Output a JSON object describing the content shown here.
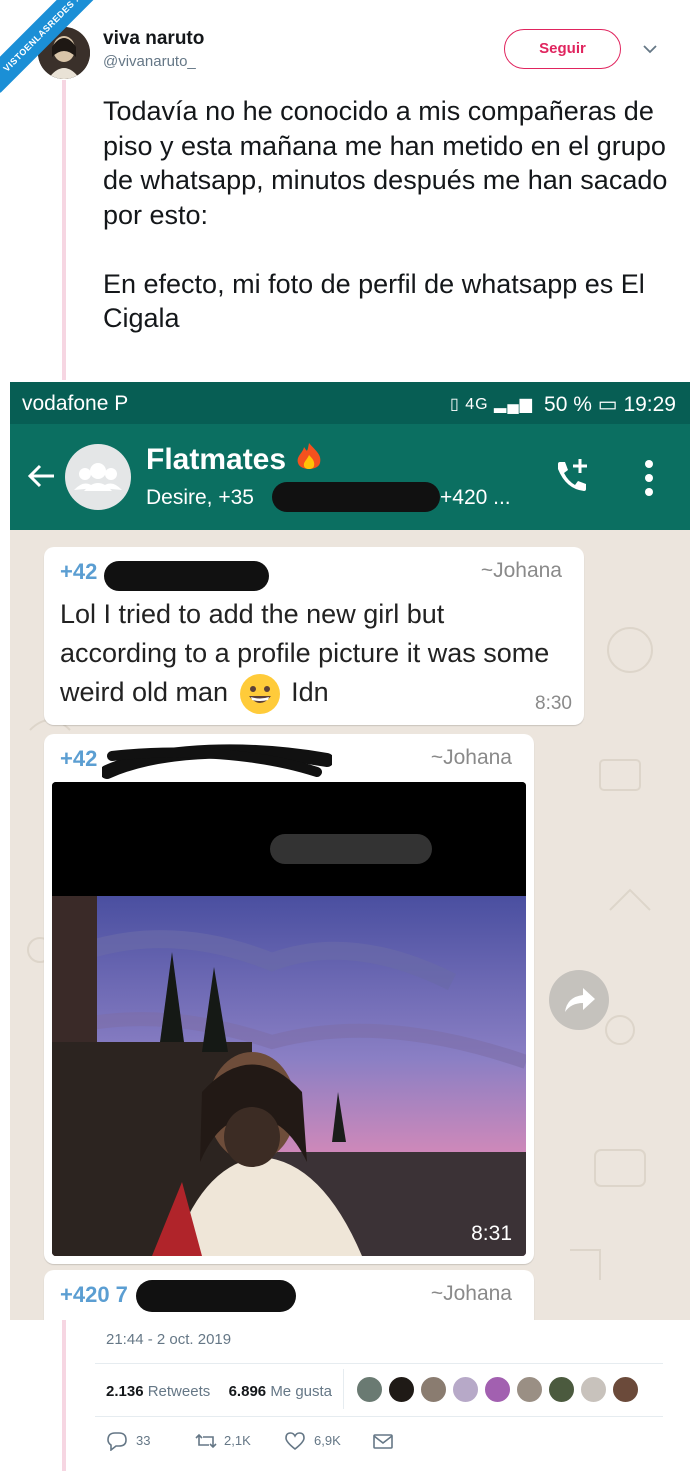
{
  "watermark": "VISTOENLASREDES .com",
  "tweet": {
    "user_name": "viva naruto",
    "user_handle": "@vivanaruto_",
    "follow_label": "Seguir",
    "text": "Todavía no he conocido a mis compañeras de piso y esta mañana me han metido en el grupo de whatsapp, minutos después me han sacado por esto:\n\nEn efecto, mi foto de perfil de whatsapp es El Cigala",
    "datetime": "21:44 - 2 oct. 2019",
    "retweets_count": "2.136",
    "retweets_label": "Retweets",
    "likes_count": "6.896",
    "likes_label": "Me gusta",
    "reply_count": "33",
    "retweet_action_count": "2,1K",
    "like_action_count": "6,9K"
  },
  "whatsapp": {
    "status_bar": {
      "carrier": "vodafone P",
      "battery": "50 %",
      "time": "19:29",
      "network": "4G"
    },
    "chat": {
      "title": "Flatmates",
      "subtitle_start": "Desire, +35",
      "subtitle_end": "+420 ..."
    },
    "messages": [
      {
        "sender": "+42",
        "alias": "~Johana",
        "text_part1": "Lol I tried to add the new girl but according to a profile picture it was some weird old man",
        "text_part2": "Idn",
        "time": "8:30"
      },
      {
        "sender": "+42",
        "alias": "~Johana",
        "time": "8:31"
      },
      {
        "sender": "+420 7",
        "alias": "~Johana"
      }
    ]
  },
  "colors": {
    "whatsapp_green": "#075e54",
    "follow_pink": "#e0245e",
    "twitter_gray": "#657786"
  },
  "icons": [
    "back-arrow-icon",
    "group-avatar-icon",
    "fire-emoji-icon",
    "add-call-icon",
    "more-vert-icon",
    "forward-icon",
    "grinning-emoji-icon",
    "reply-icon",
    "retweet-icon",
    "heart-icon",
    "mail-icon",
    "chevron-down-icon"
  ]
}
